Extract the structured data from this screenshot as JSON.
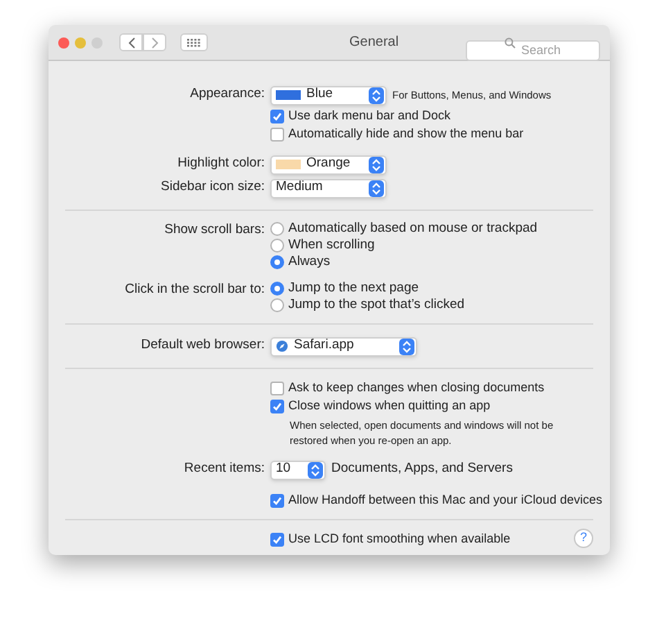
{
  "window": {
    "title": "General",
    "search": {
      "placeholder": "Search"
    }
  },
  "sections": [
    {
      "rows": [
        {
          "kind": "popup",
          "label": "Appearance:",
          "value": "Blue",
          "color": "#2f6fde",
          "suffix": "For Buttons, Menus, and Windows"
        },
        {
          "kind": "checkbox",
          "text": "Use dark menu bar and Dock",
          "checked": true
        },
        {
          "kind": "checkbox",
          "text": "Automatically hide and show the menu bar",
          "checked": false
        },
        {
          "kind": "popup",
          "label": "Highlight color:",
          "value": "Orange",
          "color": "#f9d9a9"
        },
        {
          "kind": "popup",
          "label": "Sidebar icon size:",
          "value": "Medium"
        }
      ]
    },
    {
      "rows": [
        {
          "kind": "radio_group",
          "label": "Show scroll bars:",
          "options": [
            {
              "text": "Automatically based on mouse or trackpad",
              "selected": false
            },
            {
              "text": "When scrolling",
              "selected": false
            },
            {
              "text": "Always",
              "selected": true
            }
          ]
        },
        {
          "kind": "radio_group",
          "label": "Click in the scroll bar to:",
          "options": [
            {
              "text": "Jump to the next page",
              "selected": true
            },
            {
              "text": "Jump to the spot that’s clicked",
              "selected": false
            }
          ]
        }
      ]
    },
    {
      "rows": [
        {
          "kind": "app_popup",
          "label": "Default web browser:",
          "value": "Safari.app"
        }
      ]
    },
    {
      "rows": [
        {
          "kind": "checkbox",
          "text": "Ask to keep changes when closing documents",
          "checked": false
        },
        {
          "kind": "checkbox",
          "text": "Close windows when quitting an app",
          "checked": true
        },
        {
          "kind": "note",
          "text": "When selected, open documents and windows will not be restored when you re-open an app."
        },
        {
          "kind": "number_popup",
          "label": "Recent items:",
          "value": "10",
          "suffix": "Documents, Apps, and Servers"
        },
        {
          "kind": "checkbox",
          "text": "Allow Handoff between this Mac and your iCloud devices",
          "checked": true
        }
      ]
    },
    {
      "rows": [
        {
          "kind": "checkbox",
          "text": "Use LCD font smoothing when available",
          "checked": true
        }
      ]
    }
  ],
  "help": {
    "text": "?"
  }
}
